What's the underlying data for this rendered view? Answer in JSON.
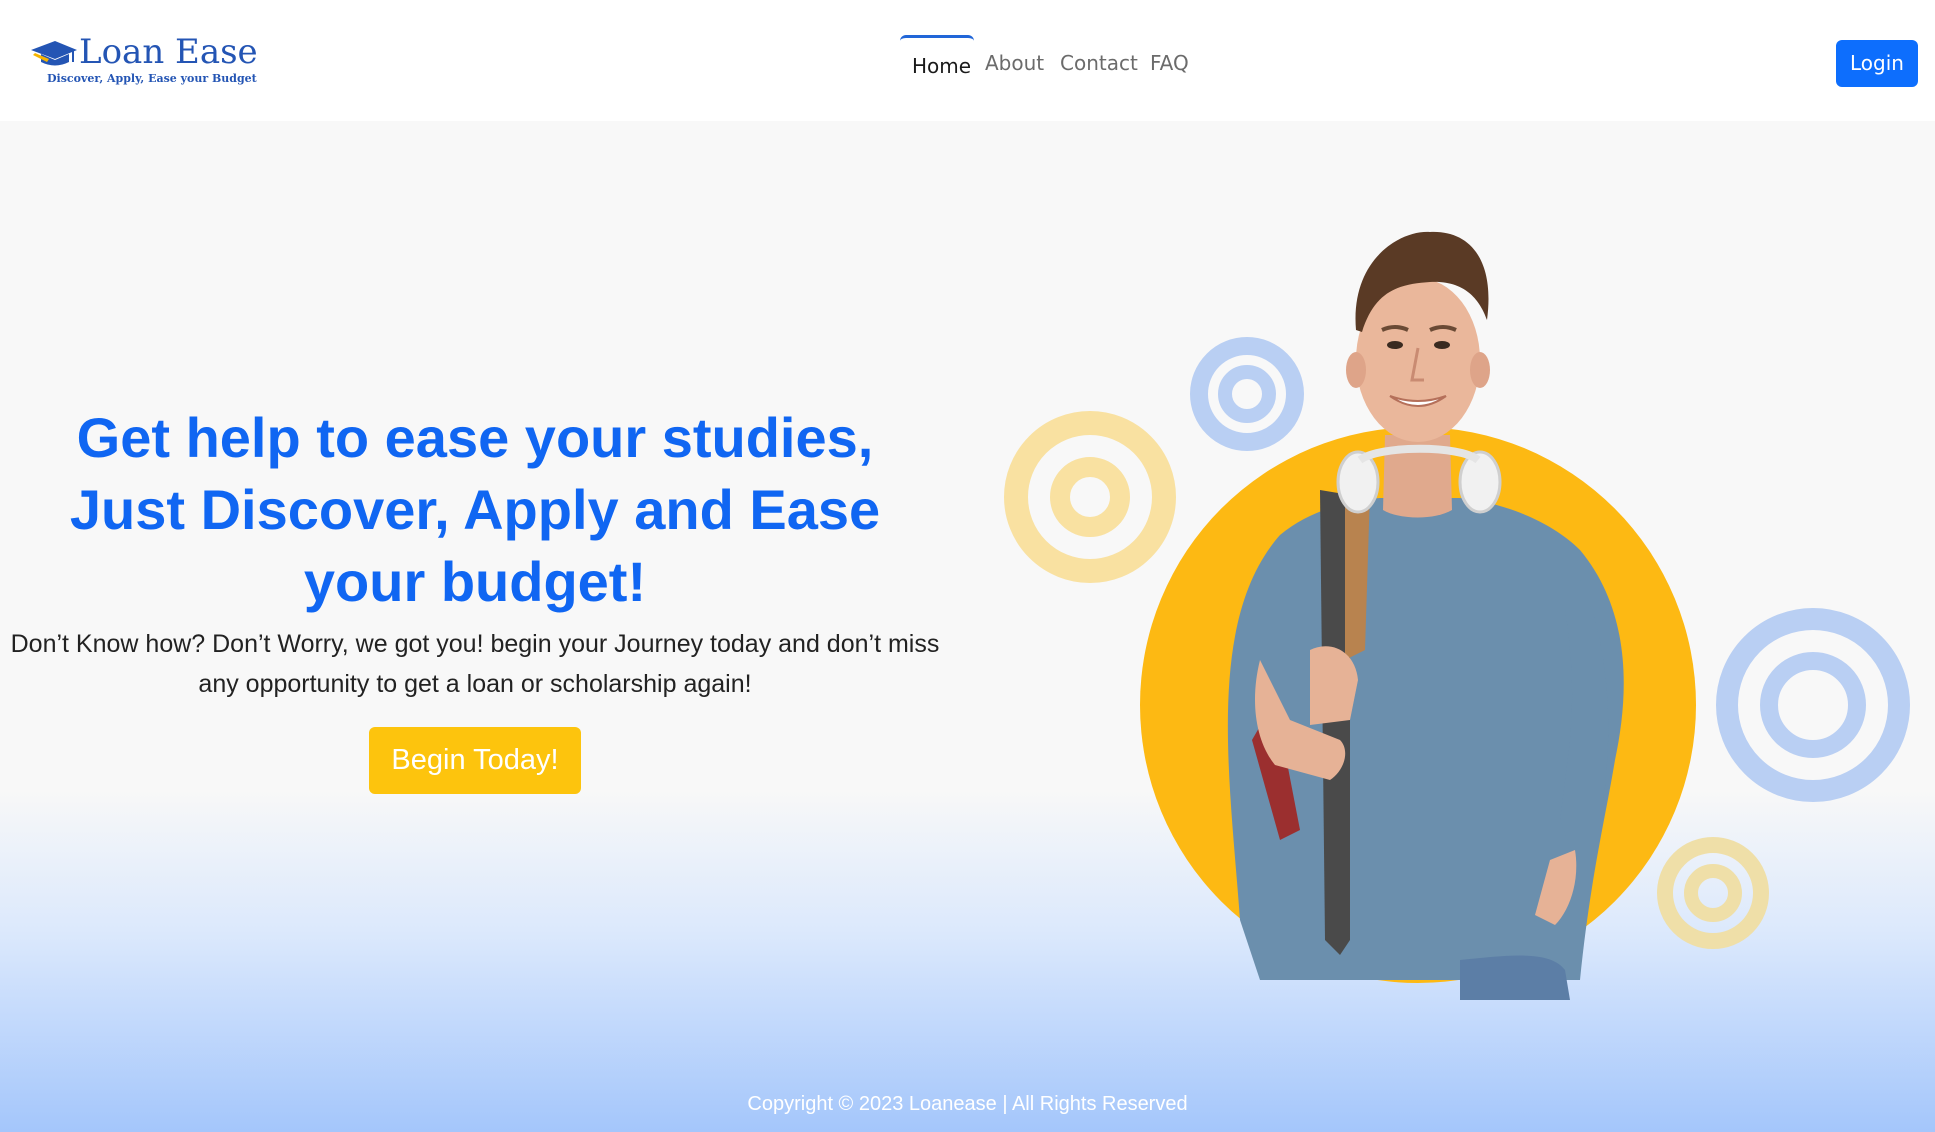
{
  "brand": {
    "name": "Loan Ease",
    "tagline": "Discover, Apply, Ease your Budget",
    "primary_color": "#1066f2",
    "accent_color": "#fdc40d"
  },
  "nav": {
    "items": [
      {
        "label": "Home",
        "active": true
      },
      {
        "label": "About",
        "active": false
      },
      {
        "label": "Contact",
        "active": false
      },
      {
        "label": "FAQ",
        "active": false
      }
    ],
    "login_label": "Login"
  },
  "hero": {
    "title": "Get help to ease your studies, Just Discover, Apply and Ease your budget!",
    "subtitle": "Don’t Know how? Don’t Worry, we got you! begin your Journey today and don’t miss any opportunity to get a loan or scholarship again!",
    "cta_label": "Begin Today!",
    "image_icon": "student-with-backpack-illustration"
  },
  "footer": {
    "copyright": "Copyright © 2023 Loanease | All Rights Reserved"
  }
}
